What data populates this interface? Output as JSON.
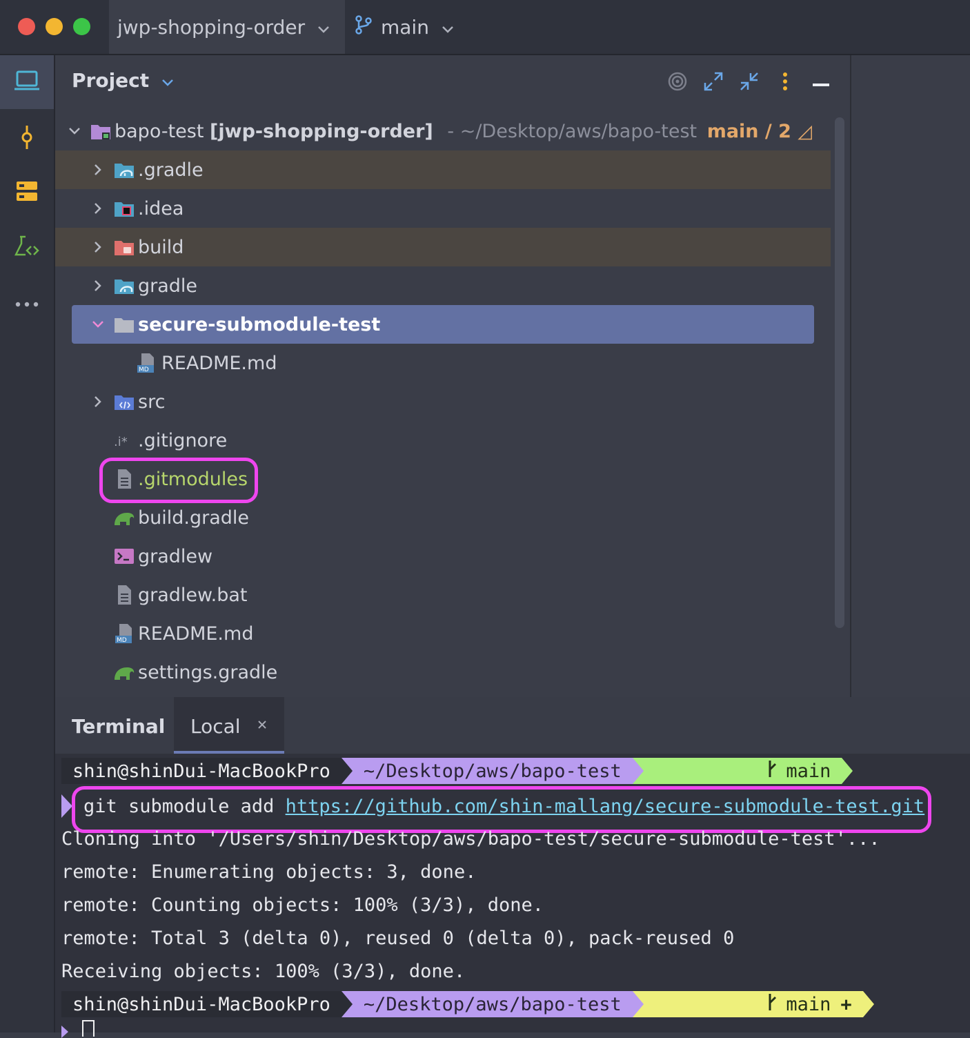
{
  "titlebar": {
    "project_name": "jwp-shopping-order",
    "branch": "main"
  },
  "project_panel": {
    "title": "Project",
    "root": {
      "name": "bapo-test",
      "module": "[jwp-shopping-order]",
      "path": "- ~/Desktop/aws/bapo-test",
      "git": "main / 2 ◿"
    },
    "items": [
      {
        "name": ".gradle"
      },
      {
        "name": ".idea"
      },
      {
        "name": "build"
      },
      {
        "name": "gradle"
      },
      {
        "name": "secure-submodule-test"
      },
      {
        "name": "README.md"
      },
      {
        "name": "src"
      },
      {
        "name": ".gitignore"
      },
      {
        "name": ".gitmodules"
      },
      {
        "name": "build.gradle"
      },
      {
        "name": "gradlew"
      },
      {
        "name": "gradlew.bat"
      },
      {
        "name": "README.md"
      },
      {
        "name": "settings.gradle"
      }
    ]
  },
  "terminal": {
    "title": "Terminal",
    "tab": "Local",
    "prompt_user": "shin@shinDui-MacBookPro",
    "prompt_path": "~/Desktop/aws/bapo-test",
    "prompt_branch": "main",
    "command": "git submodule add ",
    "command_url": "https://github.com/shin-mallang/secure-submodule-test.git",
    "output": [
      "Cloning into '/Users/shin/Desktop/aws/bapo-test/secure-submodule-test'...",
      "remote: Enumerating objects: 3, done.",
      "remote: Counting objects: 100% (3/3), done.",
      "remote: Total 3 (delta 0), reused 0 (delta 0), pack-reused 0",
      "Receiving objects: 100% (3/3), done."
    ],
    "prompt2_dirty": "+"
  },
  "colors": {
    "accent_highlight": "#ee46ee",
    "selection": "#6371a3",
    "git_added": "#b7d66c"
  }
}
